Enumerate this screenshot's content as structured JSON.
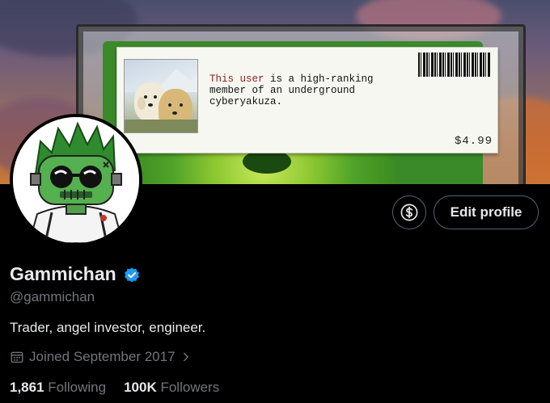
{
  "banner": {
    "card_text_highlight": "This user",
    "card_text_rest": " is a high-ranking\nmember of an underground\ncyberyakuza.",
    "price": "$4.99"
  },
  "profile": {
    "display_name": "Gammichan",
    "handle": "@gammichan",
    "bio": "Trader, angel investor, engineer.",
    "joined": "Joined September 2017",
    "following_count": "1,861",
    "following_label": "Following",
    "followers_count": "100K",
    "followers_label": "Followers",
    "verified": true
  },
  "actions": {
    "edit_profile_label": "Edit profile",
    "subscribe_icon": "dollar-circle-icon"
  },
  "colors": {
    "verified_blue": "#1d9bf0",
    "muted_text": "#71767b",
    "primary_text": "#e7e9ea",
    "background": "#000000",
    "button_border": "#536471"
  }
}
